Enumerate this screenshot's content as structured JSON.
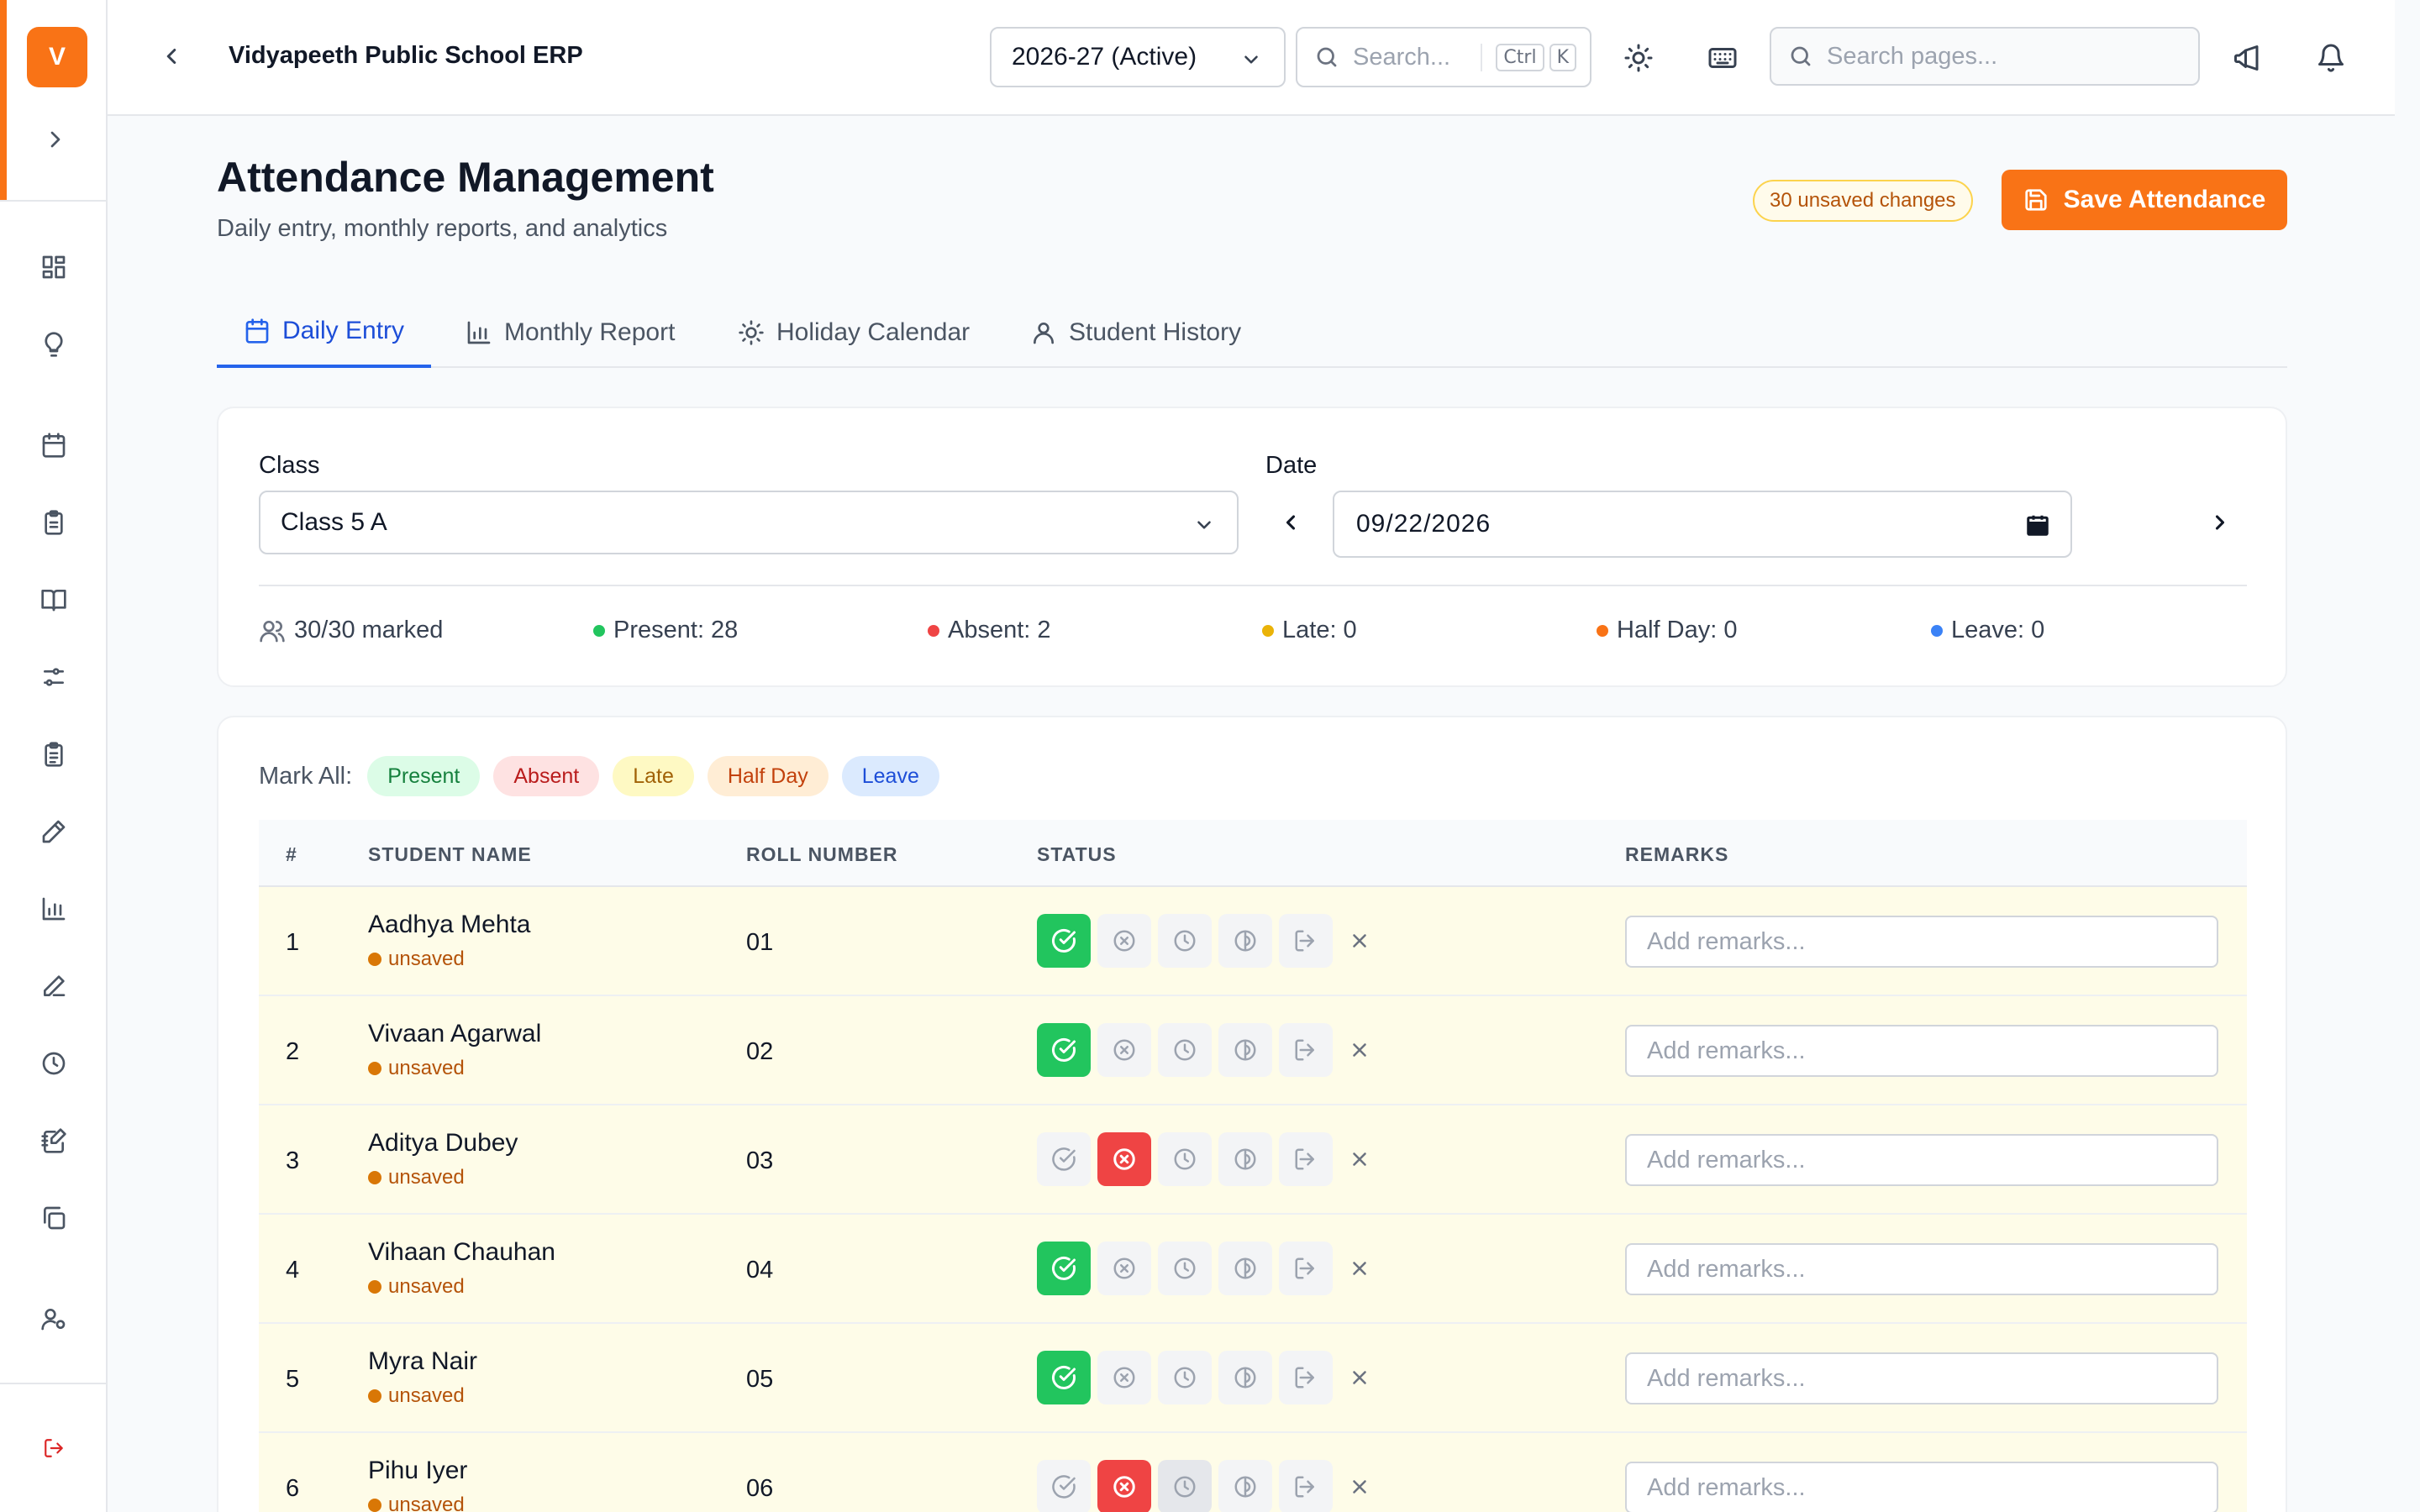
{
  "app": {
    "logo_letter": "V",
    "title": "Vidyapeeth Public School ERP"
  },
  "topbar": {
    "academic_year": "2026-27 (Active)",
    "search_placeholder": "Search...",
    "shortcut_ctrl": "Ctrl",
    "shortcut_key": "K",
    "page_search_placeholder": "Search pages..."
  },
  "header": {
    "title": "Attendance Management",
    "subtitle": "Daily entry, monthly reports, and analytics",
    "unsaved_badge": "30 unsaved changes",
    "save_label": "Save Attendance"
  },
  "tabs": [
    {
      "label": "Daily Entry",
      "icon": "calendar-icon",
      "active": true
    },
    {
      "label": "Monthly Report",
      "icon": "bar-chart-icon",
      "active": false
    },
    {
      "label": "Holiday Calendar",
      "icon": "sun-icon",
      "active": false
    },
    {
      "label": "Student History",
      "icon": "user-icon",
      "active": false
    }
  ],
  "filters": {
    "class_label": "Class",
    "class_value": "Class 5 A",
    "date_label": "Date",
    "date_value": "09/22/2026"
  },
  "stats": {
    "marked": "30/30 marked",
    "present": "Present: 28",
    "absent": "Absent: 2",
    "late": "Late: 0",
    "half_day": "Half Day: 0",
    "leave": "Leave: 0"
  },
  "mark_all": {
    "label": "Mark All:",
    "present": "Present",
    "absent": "Absent",
    "late": "Late",
    "half_day": "Half Day",
    "leave": "Leave"
  },
  "table": {
    "headers": {
      "index": "#",
      "name": "STUDENT NAME",
      "roll": "ROLL NUMBER",
      "status": "STATUS",
      "remarks": "REMARKS"
    },
    "remarks_placeholder": "Add remarks...",
    "unsaved_label": "unsaved",
    "rows": [
      {
        "index": "1",
        "name": "Aadhya Mehta",
        "roll": "01",
        "status": "present"
      },
      {
        "index": "2",
        "name": "Vivaan Agarwal",
        "roll": "02",
        "status": "present"
      },
      {
        "index": "3",
        "name": "Aditya Dubey",
        "roll": "03",
        "status": "absent"
      },
      {
        "index": "4",
        "name": "Vihaan Chauhan",
        "roll": "04",
        "status": "present"
      },
      {
        "index": "5",
        "name": "Myra Nair",
        "roll": "05",
        "status": "present"
      },
      {
        "index": "6",
        "name": "Pihu Iyer",
        "roll": "06",
        "status": "absent"
      }
    ]
  },
  "colors": {
    "brand": "#f97316",
    "tab_active": "#2563eb",
    "present": "#22c55e",
    "absent": "#ef4444",
    "late": "#eab308",
    "half_day": "#f97316",
    "leave": "#3b82f6",
    "unsaved_row": "#fefce8"
  }
}
